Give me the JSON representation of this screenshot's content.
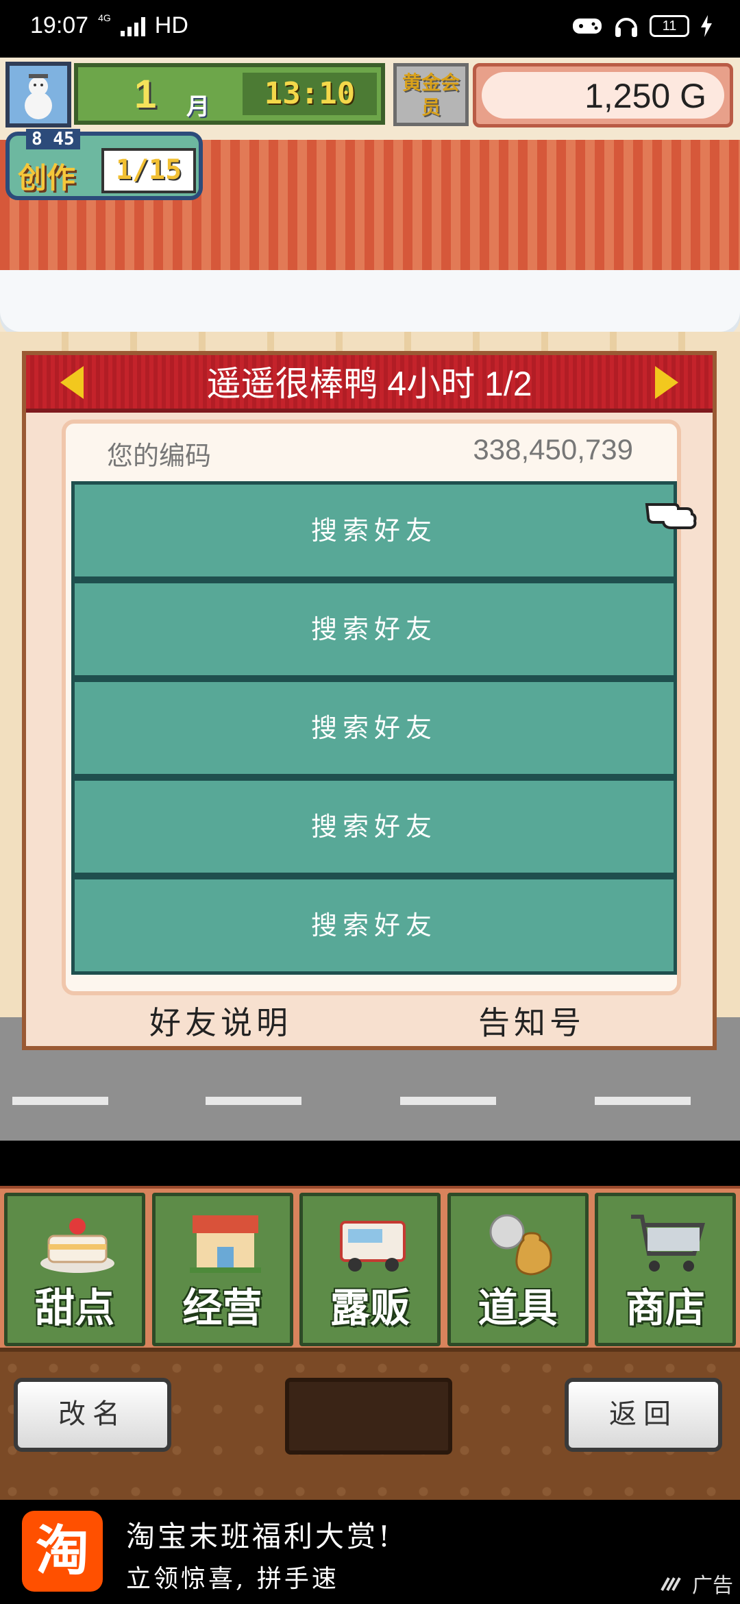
{
  "status_bar": {
    "time": "19:07",
    "network": "4G",
    "hd": "HD",
    "battery": "11"
  },
  "hud": {
    "month_number": "1",
    "month_unit": "月",
    "clock": "13:10",
    "gold_member": "黄金会员",
    "money": "1,250 G",
    "craft_level": "8 45",
    "craft_label": "创作",
    "craft_count": "1/15"
  },
  "dialog": {
    "title": "遥遥很棒鸭  4小时 1/2",
    "code_label": "您的编码",
    "code_value": "338,450,739",
    "slots": [
      "搜索好友",
      "搜索好友",
      "搜索好友",
      "搜索好友",
      "搜索好友"
    ],
    "footer_left": "好友说明",
    "footer_right": "告知号"
  },
  "menu": {
    "items": [
      {
        "label": "甜点",
        "icon": "cake-icon"
      },
      {
        "label": "经营",
        "icon": "shop-building-icon"
      },
      {
        "label": "露贩",
        "icon": "food-truck-icon"
      },
      {
        "label": "道具",
        "icon": "item-bag-icon"
      },
      {
        "label": "商店",
        "icon": "shopping-cart-icon"
      }
    ]
  },
  "actions": {
    "rename": "改名",
    "back": "返回"
  },
  "ad": {
    "logo": "淘",
    "title": "淘宝末班福利大赏!",
    "subtitle": "立领惊喜, 拼手速",
    "tag": "广告"
  }
}
